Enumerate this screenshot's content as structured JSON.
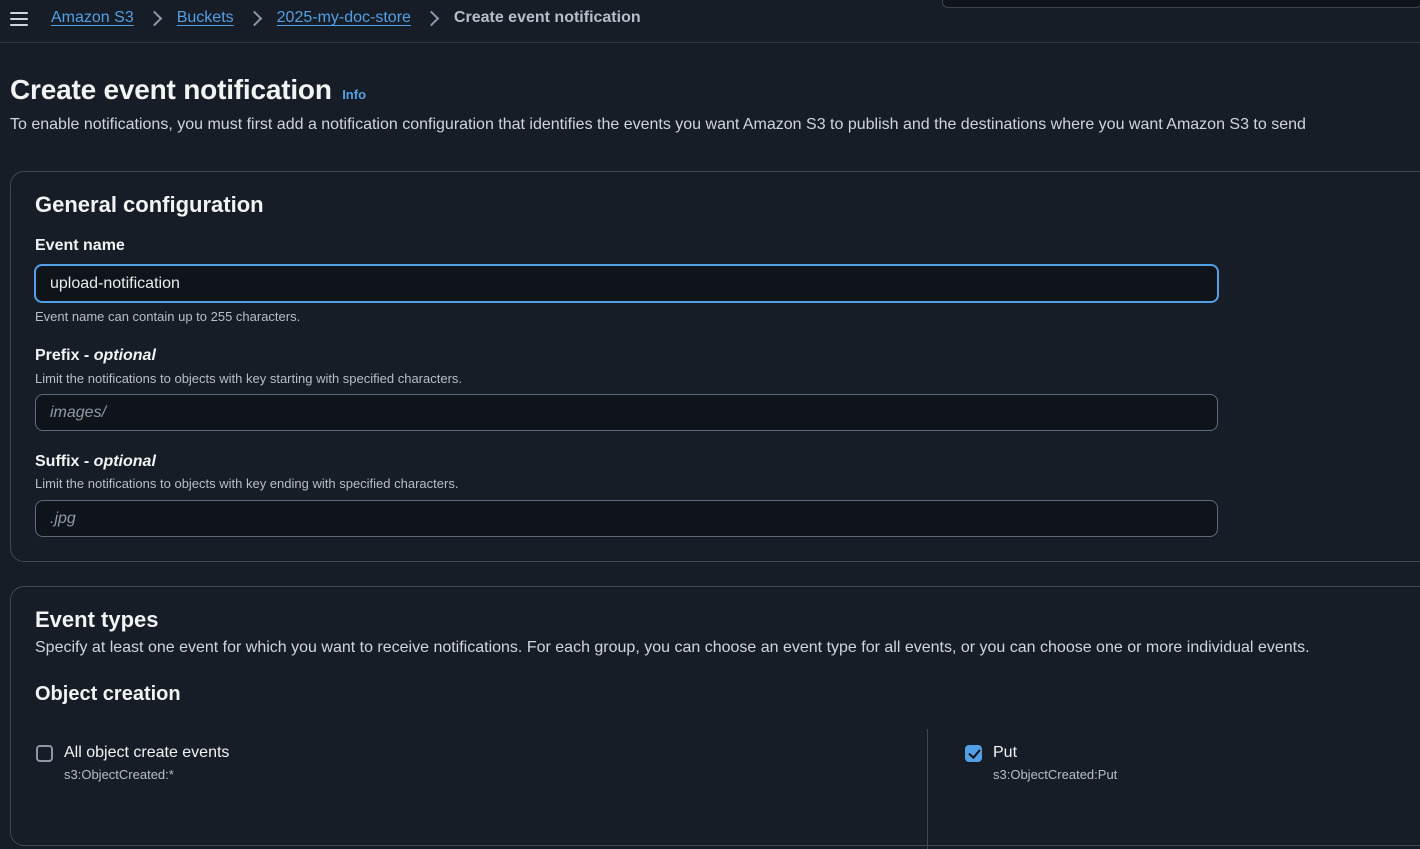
{
  "breadcrumb": {
    "items": [
      "Amazon S3",
      "Buckets",
      "2025-my-doc-store"
    ],
    "current": "Create event notification"
  },
  "page": {
    "title": "Create event notification",
    "info_link": "Info",
    "description": "To enable notifications, you must first add a notification configuration that identifies the events you want Amazon S3 to publish and the destinations where you want Amazon S3 to send"
  },
  "general": {
    "title": "General configuration",
    "event_name": {
      "label": "Event name",
      "value": "upload-notification",
      "hint": "Event name can contain up to 255 characters."
    },
    "prefix": {
      "label": "Prefix",
      "optional": "optional",
      "hint": "Limit the notifications to objects with key starting with specified characters.",
      "placeholder": "images/"
    },
    "suffix": {
      "label": "Suffix",
      "optional": "optional",
      "hint": "Limit the notifications to objects with key ending with specified characters.",
      "placeholder": ".jpg"
    }
  },
  "event_types": {
    "title": "Event types",
    "description": "Specify at least one event for which you want to receive notifications. For each group, you can choose an event type for all events, or you can choose one or more individual events.",
    "object_creation": {
      "title": "Object creation",
      "all": {
        "label": "All object create events",
        "code": "s3:ObjectCreated:*",
        "checked": false
      },
      "put": {
        "label": "Put",
        "code": "s3:ObjectCreated:Put",
        "checked": true
      }
    }
  },
  "colors": {
    "background": "#161d26",
    "link": "#539fe5",
    "border": "#424650"
  },
  "icons": [
    "menu-icon",
    "chevron-right-icon",
    "checkbox-icon"
  ]
}
